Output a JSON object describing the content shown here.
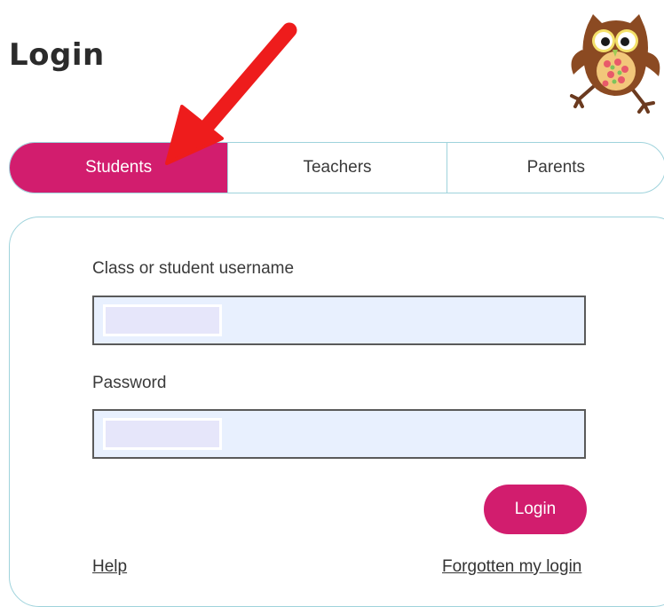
{
  "page": {
    "title": "Login"
  },
  "tabs": [
    {
      "label": "Students",
      "active": true
    },
    {
      "label": "Teachers",
      "active": false
    },
    {
      "label": "Parents",
      "active": false
    }
  ],
  "form": {
    "username_label": "Class or student username",
    "username_value": "",
    "password_label": "Password",
    "password_value": "",
    "login_label": "Login",
    "help_link": "Help",
    "forgot_link": "Forgotten my login"
  },
  "colors": {
    "accent": "#d21d6e",
    "border": "#9fd3dc",
    "field_bg": "#e8f0fe",
    "arrow": "#ee1c1c"
  },
  "icons": {
    "mascot": "owl-mascot-icon",
    "annotation": "red-arrow-icon"
  }
}
